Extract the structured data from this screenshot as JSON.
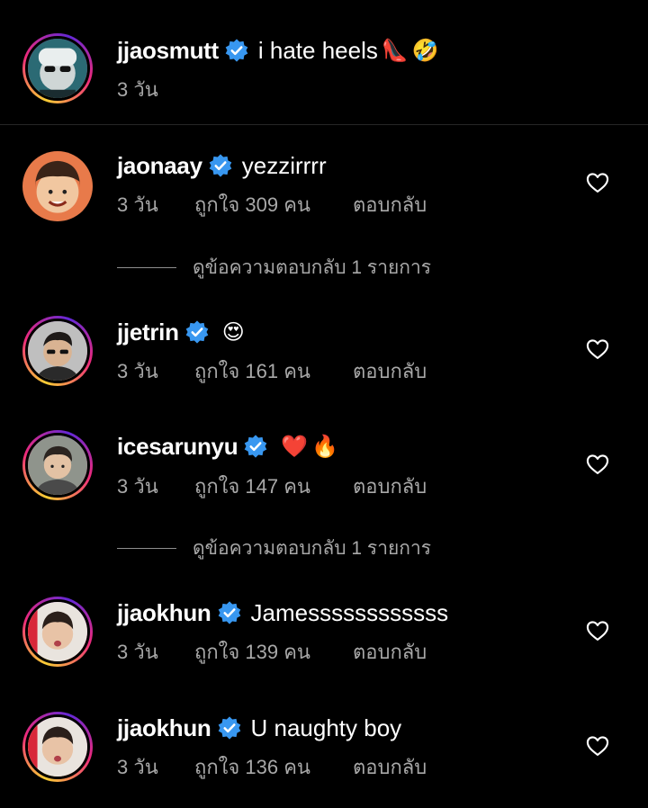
{
  "caption": {
    "username": "jjaosmutt",
    "text": "i hate heels",
    "emoji": [
      "👠",
      "🤣"
    ],
    "time": "3 วัน"
  },
  "comments": [
    {
      "username": "jaonaay",
      "text": "yezzirrrr",
      "emoji": [],
      "time": "3 วัน",
      "likes": "ถูกใจ 309 คน",
      "reply": "ตอบกลับ"
    },
    {
      "username": "jjetrin",
      "text": "",
      "emoji": [
        "😍"
      ],
      "time": "3 วัน",
      "likes": "ถูกใจ 161 คน",
      "reply": "ตอบกลับ"
    },
    {
      "username": "icesarunyu",
      "text": "",
      "emoji": [
        "❤️",
        "🔥"
      ],
      "time": "3 วัน",
      "likes": "ถูกใจ 147 คน",
      "reply": "ตอบกลับ"
    },
    {
      "username": "jjaokhun",
      "text": "Jamessssssssssss",
      "emoji": [],
      "time": "3 วัน",
      "likes": "ถูกใจ 139 คน",
      "reply": "ตอบกลับ"
    },
    {
      "username": "jjaokhun",
      "text": "U naughty boy",
      "emoji": [],
      "time": "3 วัน",
      "likes": "ถูกใจ 136 คน",
      "reply": "ตอบกลับ"
    }
  ],
  "view_replies": [
    {
      "label": "ดูข้อความตอบกลับ 1 รายการ"
    },
    {
      "label": "ดูข้อความตอบกลับ 1 รายการ"
    }
  ],
  "colors": {
    "background": "#000000",
    "verified_badge": "#3897f0",
    "secondary_text": "#a8a8a8",
    "divider": "#262626"
  },
  "icons": {
    "verified": "verified-badge-icon",
    "like": "heart-outline-icon"
  }
}
